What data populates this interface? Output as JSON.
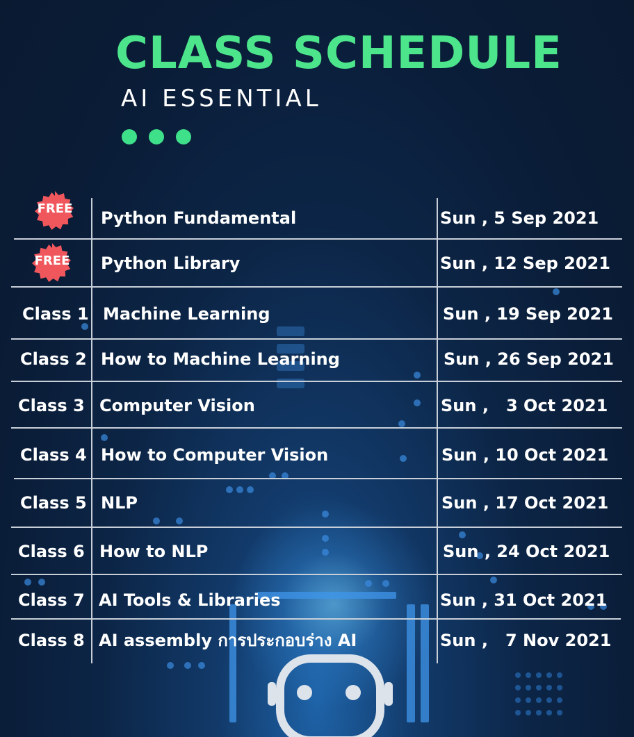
{
  "header": {
    "title": "CLASS SCHEDULE",
    "subtitle": "AI ESSENTIAL"
  },
  "colors": {
    "accent_green": "#4de58c",
    "badge_red": "#f0575d",
    "background": "#0c2546",
    "grid_lines": "#c8cfd8"
  },
  "schedule": [
    {
      "label": "FREE",
      "topic": "Python Fundamental",
      "date": "Sun , 5  Sep 2021"
    },
    {
      "label": "FREE",
      "topic": "Python Library",
      "date": "Sun , 12 Sep 2021"
    },
    {
      "label": "Class 1",
      "topic": "Machine Learning",
      "date": "Sun , 19 Sep 2021"
    },
    {
      "label": "Class 2",
      "topic": "How to Machine Learning",
      "date": "Sun , 26 Sep 2021"
    },
    {
      "label": "Class 3",
      "topic": "Computer Vision",
      "date": "Sun ,   3 Oct 2021"
    },
    {
      "label": "Class 4",
      "topic": "How to Computer Vision",
      "date": "Sun , 10 Oct 2021"
    },
    {
      "label": "Class 5",
      "topic": "NLP",
      "date": "Sun , 17 Oct 2021"
    },
    {
      "label": "Class 6",
      "topic": "How to NLP",
      "date": "Sun , 24 Oct 2021"
    },
    {
      "label": "Class 7",
      "topic": "AI Tools & Libraries",
      "date": "Sun , 31 Oct 2021"
    },
    {
      "label": "Class 8",
      "topic": "AI assembly การประกอบร่าง AI",
      "date": "Sun ,   7 Nov 2021"
    }
  ],
  "icons": {
    "badge": "free-badge-icon",
    "robot": "robot-icon",
    "dots": "dots-icon"
  }
}
